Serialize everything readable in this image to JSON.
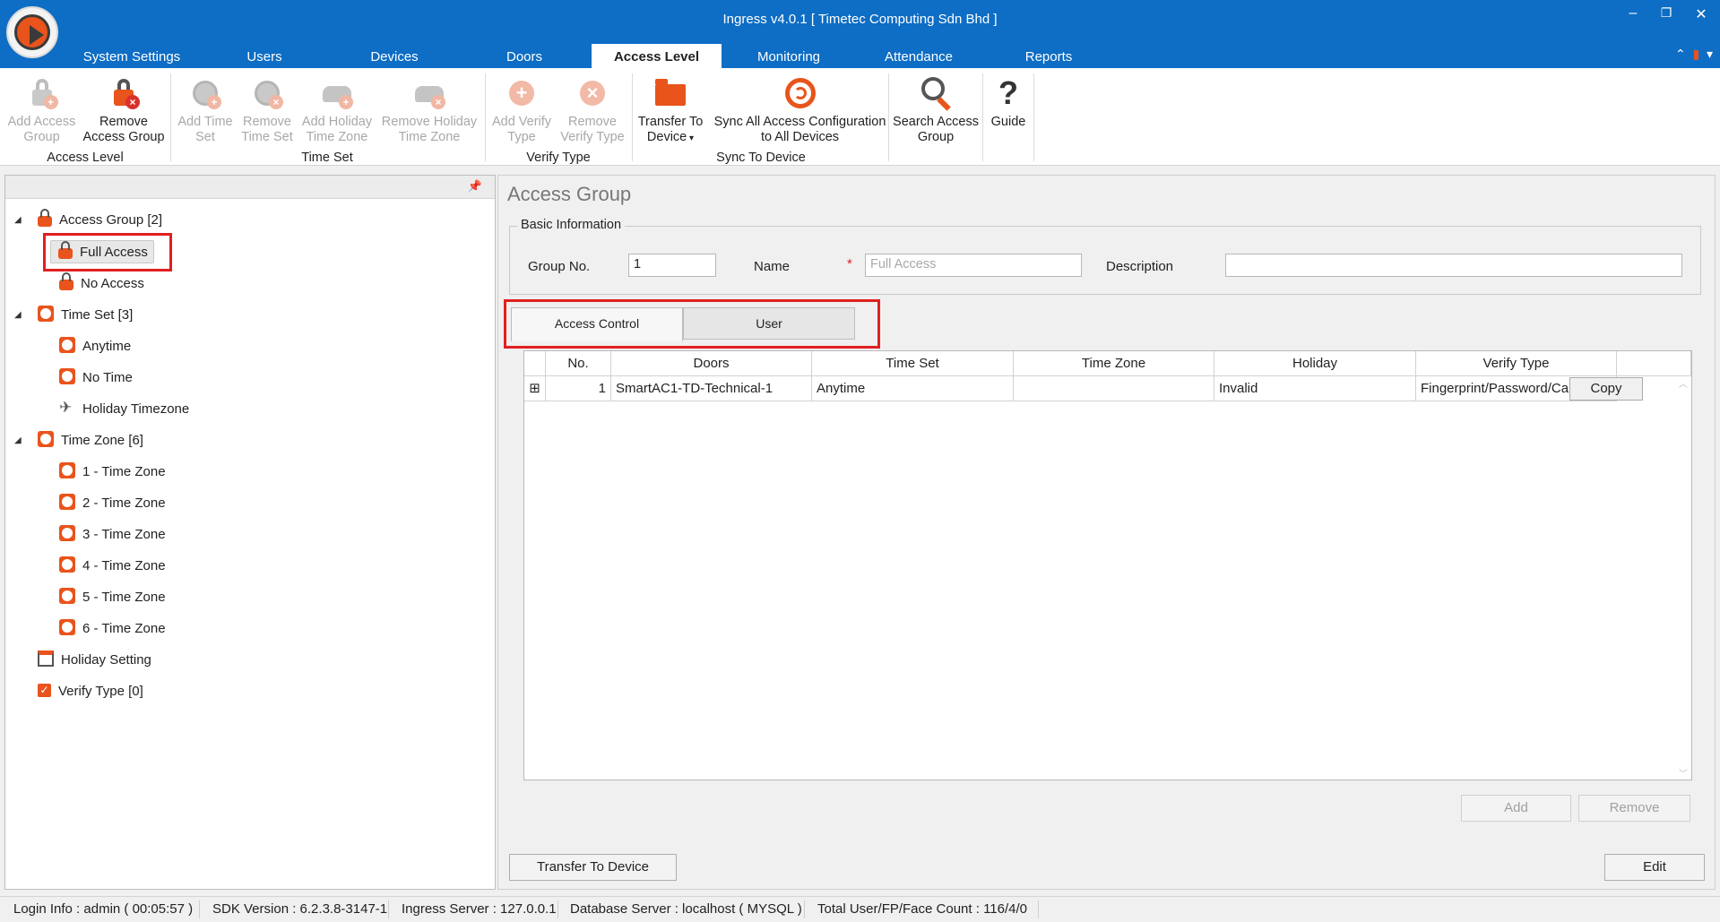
{
  "window": {
    "title": "Ingress v4.0.1 [ Timetec Computing Sdn Bhd ]",
    "minimize": "–",
    "restore": "❐",
    "close": "✕"
  },
  "menu_tabs": [
    "System Settings",
    "Users",
    "Devices",
    "Doors",
    "Access Level",
    "Monitoring",
    "Attendance",
    "Reports"
  ],
  "active_tab": "Access Level",
  "ribbon": {
    "add_access_group": "Add Access Group",
    "remove_access_group": "Remove Access Group",
    "group_access_level": "Access Level",
    "add_time_set": "Add Time Set",
    "remove_time_set": "Remove Time Set",
    "add_holiday_time_zone": "Add Holiday Time Zone",
    "remove_holiday_time_zone": "Remove Holiday Time Zone",
    "group_time_set": "Time Set",
    "add_verify_type": "Add Verify Type",
    "remove_verify_type": "Remove Verify Type",
    "group_verify_type": "Verify Type",
    "transfer_to_device": "Transfer To Device",
    "sync_all": "Sync All Access Configuration to All Devices",
    "group_sync": "Sync To Device",
    "search_access_group": "Search Access Group",
    "guide": "Guide"
  },
  "tree": {
    "access_group": "Access Group [2]",
    "full_access": "Full Access",
    "no_access": "No Access",
    "time_set": "Time Set [3]",
    "anytime": "Anytime",
    "no_time": "No Time",
    "holiday_timezone": "Holiday Timezone",
    "time_zone": "Time Zone [6]",
    "tz1": "1 - Time Zone",
    "tz2": "2 - Time Zone",
    "tz3": "3 - Time Zone",
    "tz4": "4 - Time Zone",
    "tz5": "5 - Time Zone",
    "tz6": "6 - Time Zone",
    "holiday_setting": "Holiday Setting",
    "verify_type": "Verify Type [0]"
  },
  "detail": {
    "title": "Access Group",
    "basic_info": "Basic Information",
    "group_no_label": "Group No.",
    "group_no_value": "1",
    "name_label": "Name",
    "name_placeholder": "Full Access",
    "description_label": "Description",
    "description_value": "",
    "tab_access_control": "Access Control",
    "tab_user": "User"
  },
  "grid": {
    "columns": [
      "No.",
      "Doors",
      "Time Set",
      "Time Zone",
      "Holiday",
      "Verify Type"
    ],
    "rows": [
      {
        "no": "1",
        "door": "SmartAC1-TD-Technical-1",
        "time_set": "Anytime",
        "time_zone": "",
        "holiday": "Invalid",
        "verify_type": "Fingerprint/Password/Card/Fa..."
      }
    ],
    "copy": "Copy"
  },
  "buttons": {
    "add": "Add",
    "remove": "Remove",
    "transfer_to_device": "Transfer To Device",
    "edit": "Edit"
  },
  "status": {
    "login": "Login Info : admin ( 00:05:57 )",
    "sdk": "SDK Version : 6.2.3.8-3147-1",
    "ingress_server": "Ingress Server : 127.0.0.1",
    "database_server": "Database Server : localhost ( MYSQL )",
    "count": "Total User/FP/Face Count : 116/4/0"
  },
  "colors": {
    "title_bar": "#0e6dc4",
    "accent": "#e8541c",
    "highlight_box": "#e02020"
  }
}
